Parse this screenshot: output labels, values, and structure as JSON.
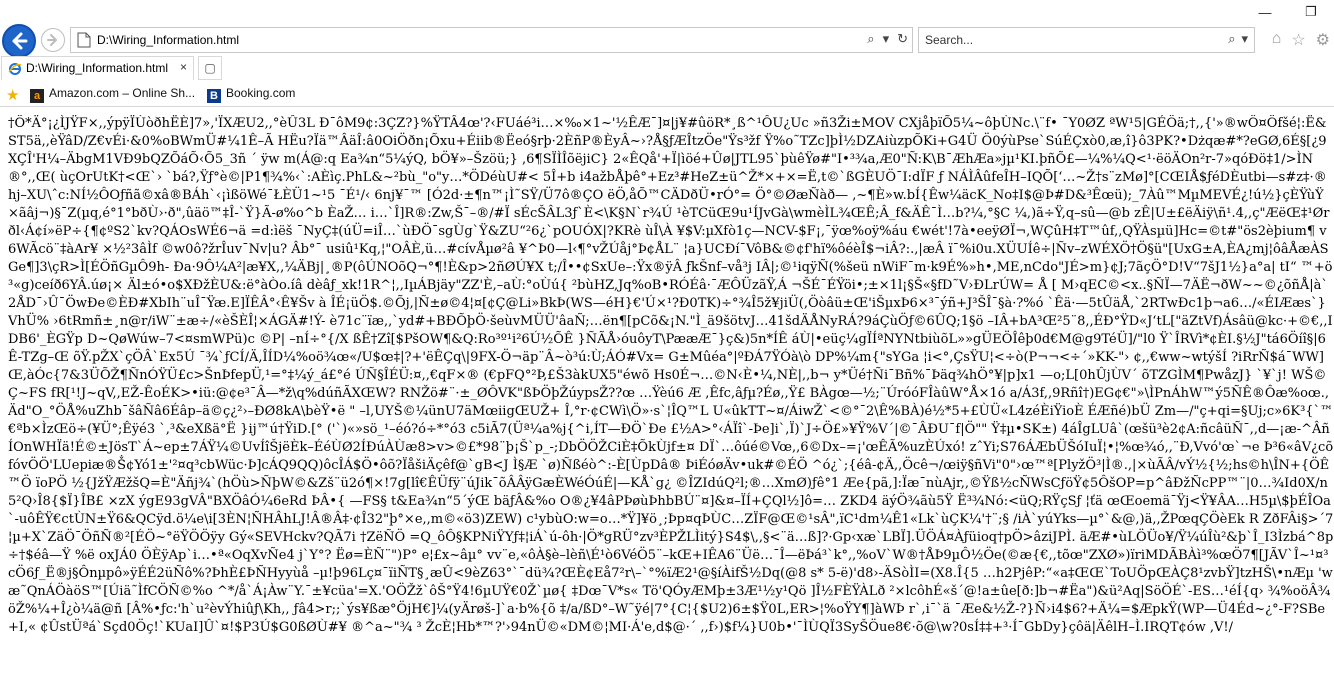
{
  "window": {
    "minimize_label": "—",
    "restore_label": "❐"
  },
  "nav": {
    "back_icon": "back-arrow-icon",
    "forward_icon": "forward-arrow-icon",
    "address_value": "D:\\Wiring_Information.html",
    "search_placeholder": "Search..."
  },
  "tab": {
    "label": "D:\\Wiring_Information.html",
    "close_label": "×"
  },
  "favorites": [
    {
      "label": "Amazon.com – Online Sh...",
      "icon": "amazon-icon"
    },
    {
      "label": "Booking.com",
      "icon": "booking-icon"
    }
  ],
  "content": {
    "text": "†Ö*Ä°¡¿ÌJŸF×,,ýpÿÏÙòðhËÈ]7»,'ÏXÆU2,,°èÛ3L Ð¯ôM9¢:3ÇZ?}%ŸTÂ4œ'?‹FUáé³i…×‰×1~'½ÊÆ¯]¤|j¥#ûöR*¸ß^¹ÔU¿Uc »ñ3Ži±MOV CXjåþïÕ5¼~ôþÙNc.\\¨f• ¯Y0ØZ ªW¹5|GÉÖä;†,,{'»®wÖ¤Öfšé¦:Ë&ST5ä,,èŸâD/Z€vÉi·&0%oBWmÜ#¼1Ê–Ã HËu?Ïä™ÂäÎ:â0OiÖðn¡Õxu+Éiib®Ëeó§rþ·2ÈñP®ÈyÂ~›?Å§ƒÆÎtzÖe\"Ÿs³žf Ÿ%o˜TZc]þÌ½DZAiùzpÕKi+G4Ü Ö0ýùPse`SúÉÇxò0,æ,î}ô3PK?•Dżqæ#*?eGØ,6É§[¿9XÇÎ'H¼–ÄbgM1VÐ9bQZÕáÕ‹Õ5_3ñ ´ ÿw m(Á@:q Ea¾n“5¼ýQ, bÖ¥»–Šzöü;} ,6¶SÏÌÎõëjiC} 2«ÊQå'+Ï|ìöé+Ûø|JTL95`þùêŸø#\"I•³¾a,Æ0\"Ñ:K\\B¯ÆhÆa»jµ¹KI.þñÕ£—¼%¼Q<¹·ëöÄOn²r-7»qóÐö‡1/>ÌN®°,,Œ( ùçOrUtK†<Œ`› `bá?,Ÿƒ°è©|P1¶¾%‹`:AÈìç.PhL&~²bù_\"o\"y…*ÖDéùU#< 5Î+b i4ažbÅþê°+Ez³#HeZ±ü^Ž*×+×=Ë,t©`ßGÈUÖ¯I:dÏF ƒ NÁÌÂûfeÎH–IQÕ[‘…~Ž†s¨zMø]°[CŒIÅ$ƒéDÈutbi—s#z‡·®hj–XU\\ˆc:NÍ½ÔOƒñã©xâ®BÁh`‹¡ìßöWé¯ŁÈÜ1~¹5 ¯É¹/‹ 6nj¥¯™ [Ó2d·±¶n™¡Ì˜SŸ/Ü7ô®ÇO ëÖ,åÕ™CÄDðÜ•rÓ°= Ö°©ØæÑàð— ,~¶È»w.bÍ{Êw¼äcK_No‡I$@Þ#D&³Êœü);_7Àû™MµMEVÉ¿!ú½}çÈŸùŸ ×ãâj¬)§¯Z(µq,é°1°bðÙ›·ð\",ûäö™‡Î-`Ÿ}Ã-ø%o^b ÈaŽ… i…`Î]R®:Zw,Š¯–®/#Ï sÉcŠÂL3ƒ`È<\\K§N`r¾Ú ¹èTCüŒ9u¹ÍJvGà\\wmèÌL¾ŒÊ;Â_f&ÄÊ¯Ì…b?¼,°§C ¼,)ã÷Ÿ,q–sû—@b zÊ|U±£ëÄiÿ\\ñ¹.4,,ç\"ÆëŒ‡¹Ørðl‹Á¢í»ëP÷{¶¢ºS2`kv?QÁOsWÉ6¬ä =d:ìëš ¯NyÇ‡(úÜ=iÎ…`ùÐÖ¯sgÙg`Ÿ&ZU“²6¿`pOUÓX|?KRè ùÎ\\À ¥$V:µXfò1ç—NCV-$F¡,¯ÿœ%oÿ%áu €wét'!7à•eeÿØÏ¬,WÇûH‡T™ûf,,QŸÀsµü]Hc=©t#\"ös2èþium¶ v6WÃcö¨‡àAr¥ ×½²3âÌf ©w0ô?žrÎuv¯Nv|u? Âb°¯ usiû¹Kq,¦\"OÂÈ,ü…#cívÅµø²â ¥^Þ0—l‹¶°vŽÚåj°Þ¢ÅL¨ ¦a}UCÐí¯VôB&©¢f'hï%ôéèÎ$¬iÂ?:.,|æÂ ï¯%i0u.XÜUÍê÷|Ñv–zWÉXÖ†Ö§ü\"[UxG±A,ÈA¿mj¦ôâÅæÀSGe¶]3\\çR>Ì[ÉÖñGµÔ9h- Ða·9Ô¼A²|æ¥X,,¼ÄBj|¸®P(ôÚNOõQ¬°¶!È&p>2ñØÚ¥X t;/Î••¢SxUe–:Ÿx®ÿÂ ƒkŠnf–vå³j IÂ|;©¹iqÿÑ(%šeü nWiF¯m·k9É%»h•,ME,nCdo\"JÉ>m}¢J;7ãçÖ°D!V“7šJ1½}a°a| tI“ ™+ö³«g)ceíð6YÂ.úø¡× Äl±ó•o$XÐžÈU&:ë°àÒo.íâ dèâƒ_xk!1R^¦,,IµÁBjäy\"ZZ'È,–aÙ:°oÙú{ ²bùHZ,Jq%oB•RÓÉâ·¯ÆÔÜzãŸ,Á ¬ŠÉ¯ÉŸöi•;±×1l¡§Š«§fD˜V›ÐLrÚW= Å [ M›qEC©<x..§ÑÏ—7ÄË¬ðW~~©¿õñÅ|à`2ÅD¯›Û¯ÖwÐe©ÈÐ#XbIh¨uÎ¯Ÿæ.E]ÏÊÂ°‹Ê¥Šv à ÎÉ¡üÖ$.©Õj,|Ñ±ø©4¦¤[¢Ç@Li»BkÞ(WS—éH}€'Ú×¹?Ð0TK)÷°¾Î5ž¥jiÜ(,Öòâü±Œ'iŠµxÞ6×³¯ýñ+J³ŠÎ¯§à·?%ó `Êä·—5tÛäÅ,`2RTwÐc1þ¬a6…/«ÉIÆæs`}VhÜ% ›6tRmñ±¸n@r/iW¨±æ÷/«èŠÈÎ¦×ÁGÄ#!Ý- è71c¨ïæ,,`yd#+BÐÕþÖ·šeùvMÜÜ'âaÑ;…ën¶[pCõ&¡N.\"Ì_ä9šötvJ…41šdÄÅNyRÁ?9áÇùÖƒ©6ÛQ;1§ö –IÂ+bA³Œ²5¨8,,ÉÐ°ŸD«J‘tL[\"äZtVf)Ásâü@kc·+©€,,IDB6'_ÈGŸp D~QøWúw–7<¤smWPü)c ©P| –nÍ÷°{/X ßÊ†Zî[$PšOW¶&Q:Ro³º¹i²6Ú½ÕÊ }ÑÃÅ›óuôyT\\PææÆ¯}ç&)5n*ÍÊ áÙ|•eüç¼gÏÍªNYNtbiùõL»»gÜEÖÎêþ0d€M@g9TéÜ]/\"l0 Ÿ`ÎRVì*¢ÈI.§½J\"tá6Öíî§|6Ê-TZg–Œ õŸ.pŽX`çÖÂ`Ex5Ú ¯¾`ƒCÍ/Ä,ÎÍD¼%oö¾œ«/U$œ‡|?+'ëÊÇq\\|9FX-Ö¬äp¨Â~ò³ú:Ù;ÁÓ#Vx= G±Mûéa°|ºÐÁ7ŸÓà\\ò DP%¼m{\"sYGa ¦i<°,ÇsŸU¦<÷ò(P¬¬<÷´»KK-\"› ¢,,€ww~wtýšÍ ?iRrÑ$á¯WW]Œ,àÓc{7&3ÜÕŽ¶ÑnÓŸÜ£c>ŠnÞfepÜ,¹=°‡¼ý_á£°é ÚÑ§ÎÉÜ:¤,,€qF×® (€pFQ°²Þ,£Š3àkUX5\"éwõ Hs0É¬…©N‹È•¼,NÈ|,,b¬ y*Üé†Ñi¯Bñ%¯Þäq¾hÖ°¥|p]x1 —o;L[0hÛjÙV´ õTZGÌM¶PwåzJ} `¥`j! WŠ©Ç~FS fR[¹!J~qV,,EŽ-ÊoÉK>•iü:@¢e³¯Â—*ž\\q%dúñÃXŒW? RNŽö#¨·±_ØÔVK\"ßÞÖþŽúypsŽ??œ …Ÿèú6 Æ ,Êfc,âƒµ?Éø,,Ÿ£ BÀgœ—½;¨ÚróóFÎàûW°Å×1ó a/Á3f,,9Rñî†)EG¢€\"»\\ÌPnÁhW™ý5ÑÊ®Ôæ%oœ.,Äd\"O_°ÖÅ%uZhb¯šâÑâ6Éâp–ä©ç¿²›–ÐØ8kA\\bèŸ•ë \" –l,UYŠ©¼ünU7äMœiigŒUŽ+ Î,°r·¢CWì\\Ö»·s`¦ÎQ™L U«ûkTT~¤/ÁiwŽ`<©°¯2\\Ê%BÀ)é½*5+£ÙÜ«L4zéÈiŸioÈ ÉÆñé)bÜ Zm—/\"ç+qi=§Uj;c»6K³{`™€ªb×ÌzŒö÷(¥Ü°;Êÿé3 `,³&eXßä°Ë }ij™ú†ŸiD.[° ('`)«»sö_¹–éó?ó÷*°ó3 c5iÃ7(Üª¼a%j{^i,ÍT—ÐÖ`Ðe £½A>°‹ÁÏî`-Þe]i`,Ï)`J÷Ö£»¥Ÿ%V´|©¯ÂÐU¯f|Ö\"\" Ÿ‡µ•SK±) 4áÎgLUâ`(œšü³è2¢A:ñcâüÑ¯,,d—¡æ-^ÂñÍOnWHÏä!É©±JösT`Á~ep±7ÁŸ¼©UvÍîŠjëÈk–ÉéÙØ2ÍÐúÀÙæ8>v>©£*98¨þ¡Š`p_-;DbÖÖŽCiÈ‡ÕkÙjf±¤ DÏ`…ôúé©Vœ,,6©Dx–=¡'œÊÃ%uzÈÚxó! zˆYi;S76ÁÆbÜŠóIuÏ¦•¦%œ¾ó,,¨Ð,Vvó'œ`¬e Þ³6«âV¿cõfóvÖÖ'LUepiæ®Ṧ¢Yó1±'²¤q³cbWüc·Þ]cÁQ9QQ)ôcÎÁ$Ö•ôõ?ÏåšiÄçêf@`gB<J Ì§Æ `ø)Ñßéò^:-È[ÙpDâ® ÞiÉóøÄv•uk#©ÉÖ ^ó¿`;{éâ-¢Ä,,Öcê¬/œiÿ§ñVi\"0\"›œ™ª[PlyžÖ³|Ì®.,|×ùÃÂ/vÝ½{½;hs©h\\ÎN+{ÖÊ™Ö ïoPÖ ½{JžŸÆžšQ=È\"Äñj¾`(hÖù>ÑþW©&Zš¨ü2ó¶×!7g[lî€ÊÜfÿ¨úJik¯õÂÂÿGæÈWéÓúÉ|—KÅ`g¿ ©ÎZIdúQ²l;®…XmØ)ƒê°1 Æe{pã,]:Ïæ¯nùAjr,,©Ÿß½cÑWsCƒöŸ¢5ÔšOP=p^âÐžÑcPP™¨|0…¾Id0X/n5²Q›Î8{$Ï}ÎB£ ×zX ýgE93gVÂ\"BXÖâÓ¼6eRd ÞÂ•{ —FS§ t&Ea¾n“5´ýŒ bäƒÂ&%o O®¿¥4âPÞøùÞhbBÚ¨¤]&¤–ÏÍ+ÇQl½]ô=… ZKD4 äýÖ¾ãù5Ÿ Ë³¾Nó:<üQ;RŸçSƒ ¦ťä œŒoemä¯Ÿj<Ÿ¥ÂA…H5µ\\$þÉÎOa`-uôÊŸ€ctÙN±Ÿ6&QCÿd.ö¼e\\i[3ÈN¦ÑHÂhLJ!Â®Â‡·¢Î32\"þ°×e,,m©«ö3)ZEW) c¹ybùO:w=o…*Ÿ]¥ö¸;Þp¤qÞÙC…ZÏF@Œ©¹sÂ\",ïC¹dm¼Ê1«Lk`ùÇK¼'†¨;§ /iÀ`yúYks—µ°`&@,)ä,,ŽPœqÇÖèEk R ZðFÂi§>´7¦µ+X`ZäÖ¯ÖñÑ®²[ÉÖ~°ëŸÖÖÿy Gý«SEVHckv?QÃ7i †ZëÑÖ =Q_ôÔ§KPNiŸYƒ‡¦iÁ`ú-ôh·|Ö*gRÜ°zv³ÈPŽLÌitý}S4$\\,,§<¨ä…ß]?·Gp‹xæ`LBÏ].ÜÖÁ¤Àƒüioq†pÖ>âziJPÌ. äÆ#•ùLÖÜo¥/Ÿ¼úÎù²&þ`Î_I3Ìzbá^8p÷†$éâ—Ÿ %ë oxJÁ0 ÖÈÿAp`i…•ª«OqXvÑe4 j`Y°? Ëø=ÈÑ¨\")P° e¦£x~âµ° vv¨e,«ôÀ§è–lèñ\\É¹ò6VéÖ5¨–kŒ+IÊA6¨Üë…¯Î—ëÞá³`k°,,%oV`W®†ÅÞ9µÔ½Öe(©æ{€,,tõœ\"ZXØ»)ïriMDÃBÀì³%œÖ7¶[JÃV`Î~¹¤³cÖ6ƒ_Ë®j§Ônµpô»ÿÉÉ2üÑô%?ÞhÈ£ÞÑHyyùå –µ!þ96Lç¤¯ïiÑT§¸æÛ<9èZ63°`¯dü¾?ŒÈ¢Eå7²r\\–`°%ïÆ2¹@§íÀifŠ½Dq(@8 s* 5-ë)'d8›-ÄSòÌI=(X8.Î{5 …h2PjêP:“«a‡ŒŒ`ToUÖpŒÀÇ8¹zvbŸ]tzHŠ\\•nÆµ 'w æ˜QnÁÖàöS™[Úiä˜ÌfCÖÑ©%o ^*/å`Á¡Àw¨Y.¯±¥cüa'=X.'OÖŽž`ôŠ°Ÿ4!6µUŸ€0Ž`µø{ ‡Dœ¯V*s« Tö'QÓyÆMþ±3Æ¹½y¹Qö ]Î½FÈŸÀLð ²×lcôhÉ«š´@!a±ûe[ð:]b¬#Ëa\")&ü²Aq|SöÖÉ`-ES…¹éÍ{q› ¾%oöÂ¾öŽ%¼+Î¿ò¼ä@ñ [Â%•ƒc:'h`u²èvÝhiûƒ\\Kh,, ƒâ4>r;;`ýs¥ßæ°ÖjH€]¼(yÄrøš-]`a·b%{õ ‡/a/ßD°–W˜ÿé|7°{C¦{$U2)6±$Ÿ0L,ER>¦%oŸY¶]àWÞ r`,i¯`ä ¯Æe&½Ž-?}Ñ›i4$6?+Ä¼=$ÆpkŸ(WP—Ü4Éd~¿°-F?SBe+I,« ¢ÛstÜªá`Sçd0Öç!`KUaI]Û`¤!$P3Ú$G0ßØÙ#¥ ®^a~\"¾ ³ ŽcÈ¦Hb*™?'›94nÜ©«DM©¦MI·Á'e,d$@·´ ,,f›)$f¼}U0b•'¯ÌÙQÏ3SyŠÖue8€·õ@\\w?0sÍ‡‡+³·Í¯GbDy}çôä|ÄêlH–Ì.IRQT¢ów ,V!/"
  }
}
